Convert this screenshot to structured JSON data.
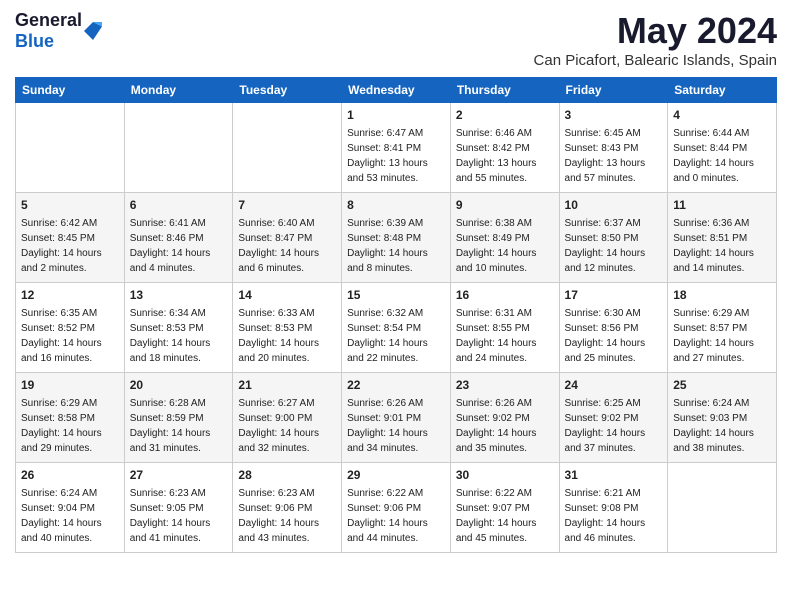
{
  "header": {
    "logo": {
      "general": "General",
      "blue": "Blue"
    },
    "title": "May 2024",
    "location": "Can Picafort, Balearic Islands, Spain"
  },
  "calendar": {
    "days_of_week": [
      "Sunday",
      "Monday",
      "Tuesday",
      "Wednesday",
      "Thursday",
      "Friday",
      "Saturday"
    ],
    "weeks": [
      [
        {
          "day": "",
          "info": ""
        },
        {
          "day": "",
          "info": ""
        },
        {
          "day": "",
          "info": ""
        },
        {
          "day": "1",
          "info": "Sunrise: 6:47 AM\nSunset: 8:41 PM\nDaylight: 13 hours\nand 53 minutes."
        },
        {
          "day": "2",
          "info": "Sunrise: 6:46 AM\nSunset: 8:42 PM\nDaylight: 13 hours\nand 55 minutes."
        },
        {
          "day": "3",
          "info": "Sunrise: 6:45 AM\nSunset: 8:43 PM\nDaylight: 13 hours\nand 57 minutes."
        },
        {
          "day": "4",
          "info": "Sunrise: 6:44 AM\nSunset: 8:44 PM\nDaylight: 14 hours\nand 0 minutes."
        }
      ],
      [
        {
          "day": "5",
          "info": "Sunrise: 6:42 AM\nSunset: 8:45 PM\nDaylight: 14 hours\nand 2 minutes."
        },
        {
          "day": "6",
          "info": "Sunrise: 6:41 AM\nSunset: 8:46 PM\nDaylight: 14 hours\nand 4 minutes."
        },
        {
          "day": "7",
          "info": "Sunrise: 6:40 AM\nSunset: 8:47 PM\nDaylight: 14 hours\nand 6 minutes."
        },
        {
          "day": "8",
          "info": "Sunrise: 6:39 AM\nSunset: 8:48 PM\nDaylight: 14 hours\nand 8 minutes."
        },
        {
          "day": "9",
          "info": "Sunrise: 6:38 AM\nSunset: 8:49 PM\nDaylight: 14 hours\nand 10 minutes."
        },
        {
          "day": "10",
          "info": "Sunrise: 6:37 AM\nSunset: 8:50 PM\nDaylight: 14 hours\nand 12 minutes."
        },
        {
          "day": "11",
          "info": "Sunrise: 6:36 AM\nSunset: 8:51 PM\nDaylight: 14 hours\nand 14 minutes."
        }
      ],
      [
        {
          "day": "12",
          "info": "Sunrise: 6:35 AM\nSunset: 8:52 PM\nDaylight: 14 hours\nand 16 minutes."
        },
        {
          "day": "13",
          "info": "Sunrise: 6:34 AM\nSunset: 8:53 PM\nDaylight: 14 hours\nand 18 minutes."
        },
        {
          "day": "14",
          "info": "Sunrise: 6:33 AM\nSunset: 8:53 PM\nDaylight: 14 hours\nand 20 minutes."
        },
        {
          "day": "15",
          "info": "Sunrise: 6:32 AM\nSunset: 8:54 PM\nDaylight: 14 hours\nand 22 minutes."
        },
        {
          "day": "16",
          "info": "Sunrise: 6:31 AM\nSunset: 8:55 PM\nDaylight: 14 hours\nand 24 minutes."
        },
        {
          "day": "17",
          "info": "Sunrise: 6:30 AM\nSunset: 8:56 PM\nDaylight: 14 hours\nand 25 minutes."
        },
        {
          "day": "18",
          "info": "Sunrise: 6:29 AM\nSunset: 8:57 PM\nDaylight: 14 hours\nand 27 minutes."
        }
      ],
      [
        {
          "day": "19",
          "info": "Sunrise: 6:29 AM\nSunset: 8:58 PM\nDaylight: 14 hours\nand 29 minutes."
        },
        {
          "day": "20",
          "info": "Sunrise: 6:28 AM\nSunset: 8:59 PM\nDaylight: 14 hours\nand 31 minutes."
        },
        {
          "day": "21",
          "info": "Sunrise: 6:27 AM\nSunset: 9:00 PM\nDaylight: 14 hours\nand 32 minutes."
        },
        {
          "day": "22",
          "info": "Sunrise: 6:26 AM\nSunset: 9:01 PM\nDaylight: 14 hours\nand 34 minutes."
        },
        {
          "day": "23",
          "info": "Sunrise: 6:26 AM\nSunset: 9:02 PM\nDaylight: 14 hours\nand 35 minutes."
        },
        {
          "day": "24",
          "info": "Sunrise: 6:25 AM\nSunset: 9:02 PM\nDaylight: 14 hours\nand 37 minutes."
        },
        {
          "day": "25",
          "info": "Sunrise: 6:24 AM\nSunset: 9:03 PM\nDaylight: 14 hours\nand 38 minutes."
        }
      ],
      [
        {
          "day": "26",
          "info": "Sunrise: 6:24 AM\nSunset: 9:04 PM\nDaylight: 14 hours\nand 40 minutes."
        },
        {
          "day": "27",
          "info": "Sunrise: 6:23 AM\nSunset: 9:05 PM\nDaylight: 14 hours\nand 41 minutes."
        },
        {
          "day": "28",
          "info": "Sunrise: 6:23 AM\nSunset: 9:06 PM\nDaylight: 14 hours\nand 43 minutes."
        },
        {
          "day": "29",
          "info": "Sunrise: 6:22 AM\nSunset: 9:06 PM\nDaylight: 14 hours\nand 44 minutes."
        },
        {
          "day": "30",
          "info": "Sunrise: 6:22 AM\nSunset: 9:07 PM\nDaylight: 14 hours\nand 45 minutes."
        },
        {
          "day": "31",
          "info": "Sunrise: 6:21 AM\nSunset: 9:08 PM\nDaylight: 14 hours\nand 46 minutes."
        },
        {
          "day": "",
          "info": ""
        }
      ]
    ]
  }
}
